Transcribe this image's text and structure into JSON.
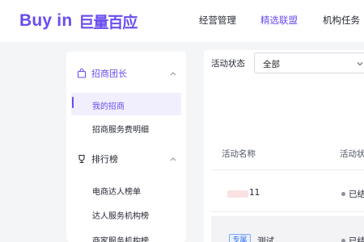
{
  "header": {
    "logo_en": "Buy in",
    "logo_cn": "巨量百应",
    "nav": [
      {
        "label": "经营管理",
        "active": false
      },
      {
        "label": "精选联盟",
        "active": true
      },
      {
        "label": "机构任务",
        "active": false
      }
    ]
  },
  "sidebar": {
    "groups": [
      {
        "label": "招商团长",
        "icon": "bag-icon",
        "expanded": true,
        "items": [
          {
            "label": "我的招商",
            "active": true
          },
          {
            "label": "招商服务费明细",
            "active": false
          }
        ]
      },
      {
        "label": "排行榜",
        "icon": "trophy-icon",
        "expanded": true,
        "items": [
          {
            "label": "电商达人榜单"
          },
          {
            "label": "达人服务机构榜"
          },
          {
            "label": "商家服务机构榜"
          }
        ]
      }
    ]
  },
  "main": {
    "filter_label": "活动状态",
    "filter_value": "全部",
    "columns": [
      "活动名称",
      "活动状态"
    ],
    "rows": [
      {
        "tag": "",
        "name": "11",
        "status": "已结束"
      },
      {
        "tag": "专属",
        "name": "测试",
        "status": "已结束"
      }
    ]
  },
  "colors": {
    "accent": "#6a4cf0",
    "tag_blue": "#2f6fee",
    "active_bg": "#f1eefe"
  }
}
